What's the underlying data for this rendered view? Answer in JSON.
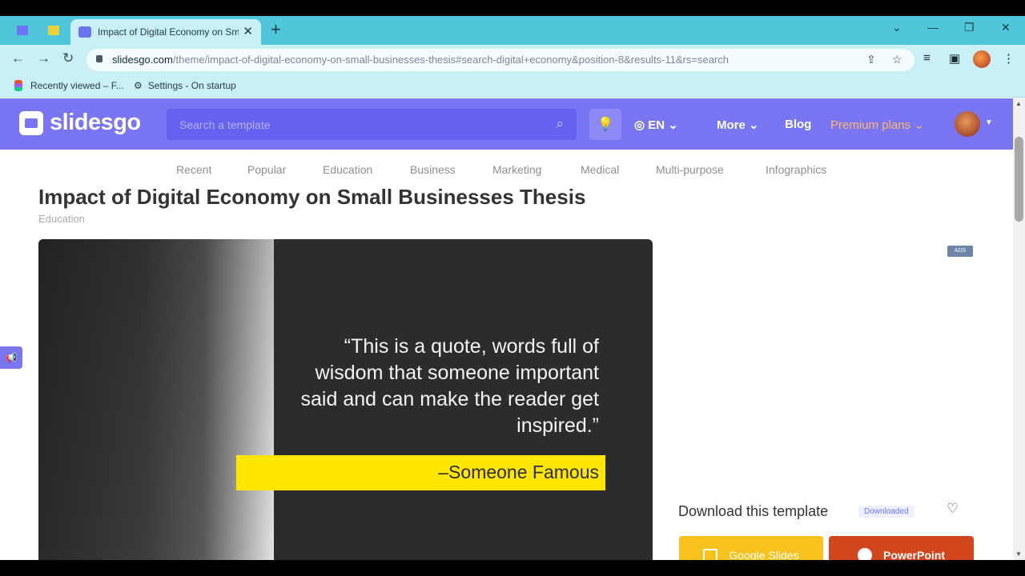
{
  "browser": {
    "tab_title": "Impact of Digital Economy on Sm",
    "tab_close": "✕",
    "new_tab": "+",
    "url_host": "slidesgo.com",
    "url_path": "/theme/impact-of-digital-economy-on-small-businesses-thesis#search-digital+economy&position-8&results-11&rs=search",
    "window_controls": {
      "dropdown": "⌄",
      "minimize": "—",
      "restore": "❐",
      "close": "✕"
    },
    "nav": {
      "back": "←",
      "forward": "→",
      "reload": "↻"
    }
  },
  "bookmarks": [
    {
      "label": "Recently viewed – F...",
      "icon": "figma-icon"
    },
    {
      "label": "Settings - On startup",
      "icon": "gear-icon"
    }
  ],
  "site": {
    "logo_text": "slidesgo",
    "search_placeholder": "Search a template",
    "language": "EN",
    "nav": {
      "more": "More",
      "blog": "Blog",
      "premium": "Premium plans"
    },
    "categories": [
      "Recent",
      "Popular",
      "Education",
      "Business",
      "Marketing",
      "Medical",
      "Multi-purpose",
      "Infographics"
    ]
  },
  "page": {
    "title": "Impact of Digital Economy on Small Businesses Thesis",
    "category": "Education",
    "ad_badge": "ADS",
    "preview": {
      "quote": "“This is a quote, words full of wisdom that someone important said and can make the reader get inspired.”",
      "author": "–Someone Famous"
    },
    "download": {
      "title": "Download this template",
      "badge": "Downloaded",
      "google_slides": "Google Slides",
      "powerpoint": "PowerPoint"
    }
  },
  "colors": {
    "brand": "#7a75f3",
    "premium": "#ffb86b",
    "google_slides": "#f6c21b",
    "powerpoint": "#d2461d",
    "quote_highlight": "#ffe600"
  }
}
